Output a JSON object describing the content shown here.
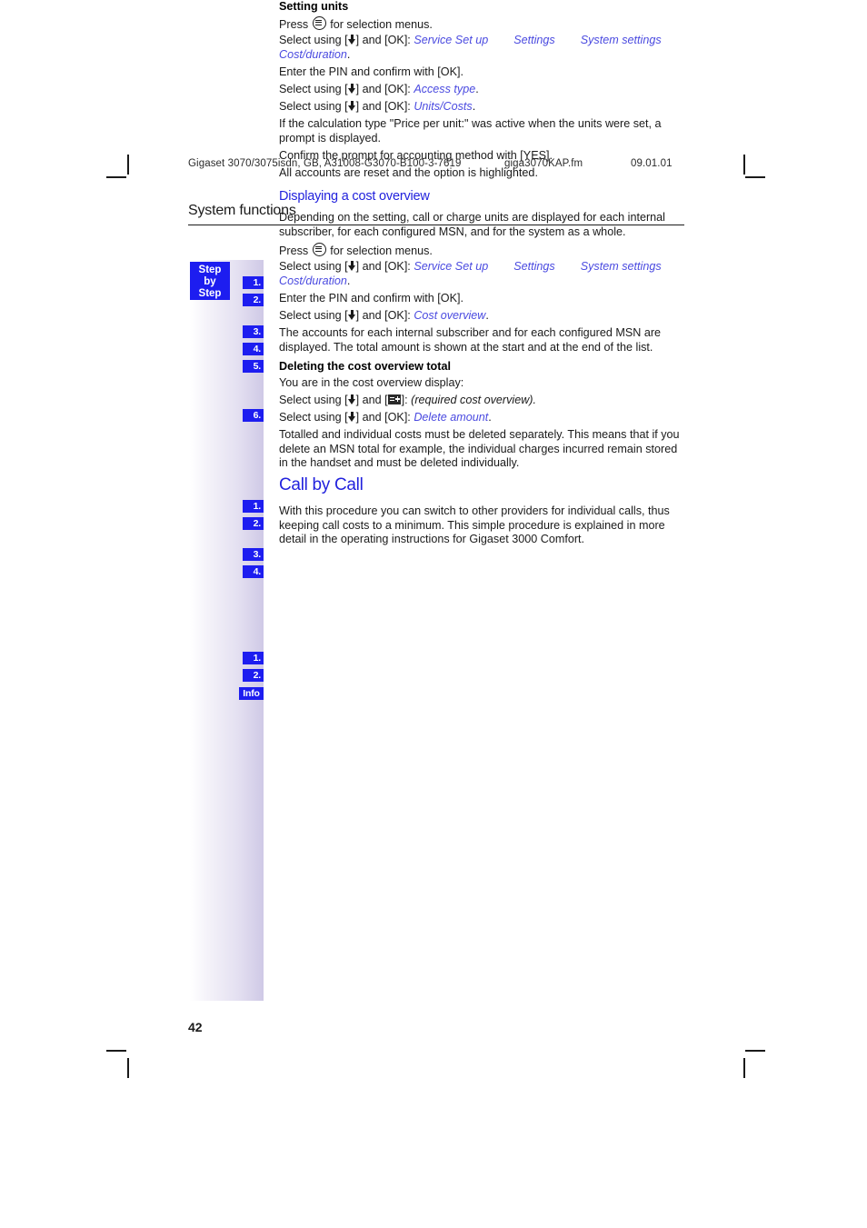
{
  "running_header": {
    "document_id": "Gigaset 3070/3075isdn, GB, A31008-G3070-B100-3-7619",
    "filename": "giga3070KAP.fm",
    "date": "09.01.01"
  },
  "chapter_title": "System functions",
  "margin": {
    "step_by_step_label": "Step\nby\nStep",
    "step_by_step_line1": "Step",
    "step_by_step_line2": "by",
    "step_by_step_line3": "Step",
    "info_label": "Info",
    "chips": [
      "1.",
      "2.",
      "3.",
      "4.",
      "5.",
      "6."
    ]
  },
  "sections": {
    "setting_units": {
      "heading": "Setting units",
      "step1_pre": "Press",
      "step1_post": "for selection menus.",
      "step2_pre": "Select using [",
      "step2_mid": "] and [OK]:",
      "step2_menu1": "Service Set up",
      "step2_menu2": "Settings",
      "step2_menu3": "System settings",
      "step2_menu4": "Cost/duration",
      "step2_end": ".",
      "step3": "Enter the PIN and confirm with [OK].",
      "step4_menu": "Access type",
      "step5_menu": "Units/Costs",
      "note": "If the calculation type \"Price per unit:\" was active when the units were set, a prompt is displayed.",
      "step6": "Confirm the prompt for accounting method with [YES].",
      "result": "All accounts are reset and the option is highlighted."
    },
    "cost_overview": {
      "heading": "Displaying a cost overview",
      "intro": "Depending on the setting, call or charge units are displayed for each internal subscriber, for each configured MSN, and for the system as a whole.",
      "step1_pre": "Press",
      "step1_post": "for selection menus.",
      "step2_pre": "Select using [",
      "step2_mid": "] and [OK]:",
      "step2_menu1": "Service Set up",
      "step2_menu2": "Settings",
      "step2_menu3": "System settings",
      "step2_menu4": "Cost/duration",
      "step3": "Enter the PIN and confirm with [OK].",
      "step4_menu": "Cost overview",
      "result": "The accounts for each internal subscriber and for each configured MSN are displayed. The total amount is shown at the start and at the end of the list."
    },
    "deleting_total": {
      "heading": "Deleting the cost overview total",
      "intro": "You are in the cost overview display:",
      "step1_pre": "Select using [",
      "step1_mid": "] and [",
      "step1_post": "]:",
      "step1_italic": "(required cost overview).",
      "step2_pre": "Select using [",
      "step2_mid": "] and [OK]:",
      "step2_menu": "Delete amount",
      "step2_end": ".",
      "info_text": "Totalled and individual costs must be deleted separately. This means that if you delete an MSN total for example, the individual charges incurred remain stored in the handset and must be deleted individually."
    },
    "call_by_call": {
      "heading": "Call by Call",
      "body": "With this procedure you can switch to other providers for individual calls, thus keeping call costs to a minimum. This simple procedure is explained in more detail in the operating instructions for Gigaset 3000 Comfort."
    }
  },
  "folio": "42",
  "colors": {
    "accent_blue": "#1d1df0",
    "heading_blue": "#2222dd",
    "menu_italic_blue": "#4a4ae0",
    "band_gradient_end": "#cfc9e6"
  }
}
